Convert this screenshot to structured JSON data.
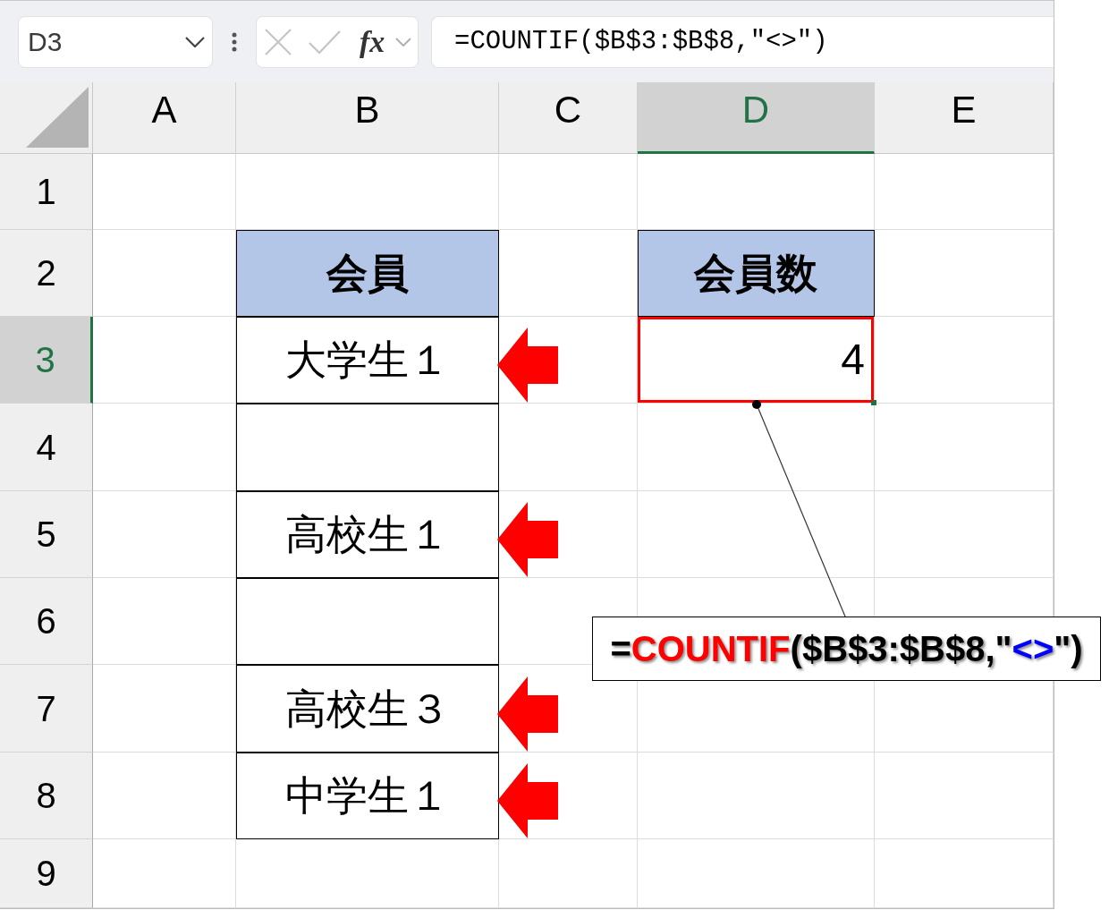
{
  "formula_bar": {
    "name_box": "D3",
    "function_label": "fx",
    "formula": "=COUNTIF($B$3:$B$8,\"<>\")"
  },
  "columns": [
    {
      "label": "A",
      "selected": false
    },
    {
      "label": "B",
      "selected": false
    },
    {
      "label": "C",
      "selected": false
    },
    {
      "label": "D",
      "selected": true
    },
    {
      "label": "E",
      "selected": false
    }
  ],
  "rows": [
    {
      "label": "1",
      "selected": false
    },
    {
      "label": "2",
      "selected": false,
      "cell_b": {
        "kind": "header",
        "text": "会員"
      },
      "cell_d": {
        "kind": "header",
        "text": "会員数"
      }
    },
    {
      "label": "3",
      "selected": true,
      "cell_b": {
        "kind": "entry",
        "text": "大学生１",
        "arrow": true
      },
      "cell_d": {
        "kind": "value",
        "text": "4",
        "selected": true
      }
    },
    {
      "label": "4",
      "selected": false,
      "cell_b": {
        "kind": "entry",
        "arrow": false
      }
    },
    {
      "label": "5",
      "selected": false,
      "cell_b": {
        "kind": "entry",
        "text": "高校生１",
        "arrow": true
      }
    },
    {
      "label": "6",
      "selected": false,
      "cell_b": {
        "kind": "entry",
        "arrow": false
      }
    },
    {
      "label": "7",
      "selected": false,
      "cell_b": {
        "kind": "entry",
        "text": "高校生３",
        "arrow": true
      }
    },
    {
      "label": "8",
      "selected": false,
      "cell_b": {
        "kind": "entry",
        "text": "中学生１",
        "arrow": true
      }
    },
    {
      "label": "9",
      "selected": false
    }
  ],
  "callout": {
    "parts": [
      {
        "text": "=",
        "color": "#000000"
      },
      {
        "text": "COUNTIF",
        "color": "#ff0000"
      },
      {
        "text": "($B$3:$B$8,\"",
        "color": "#000000"
      },
      {
        "text": "<>",
        "color": "#0000ff"
      },
      {
        "text": "\")",
        "color": "#000000"
      }
    ]
  }
}
